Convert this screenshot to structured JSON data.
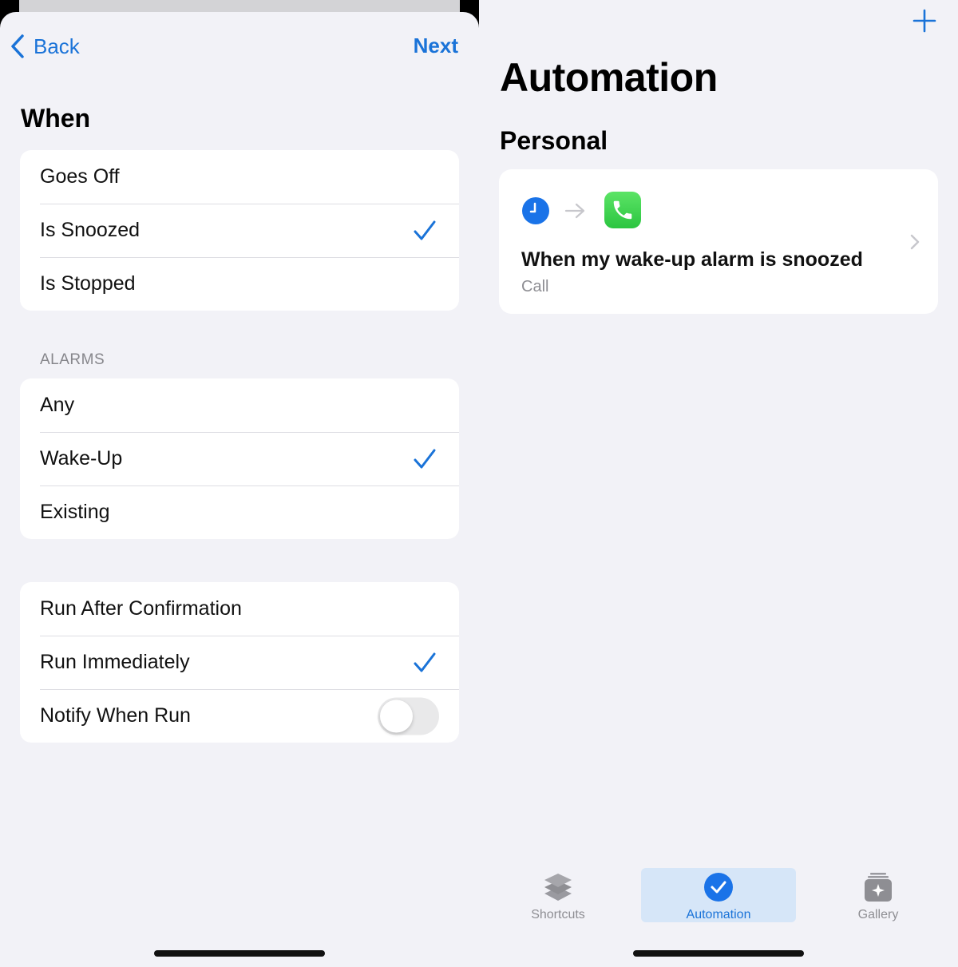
{
  "left": {
    "nav": {
      "back_label": "Back",
      "next_label": "Next"
    },
    "when": {
      "title": "When",
      "options": [
        {
          "label": "Goes Off",
          "checked": false
        },
        {
          "label": "Is Snoozed",
          "checked": true
        },
        {
          "label": "Is Stopped",
          "checked": false
        }
      ]
    },
    "alarms": {
      "header": "ALARMS",
      "options": [
        {
          "label": "Any",
          "checked": false
        },
        {
          "label": "Wake-Up",
          "checked": true
        },
        {
          "label": "Existing",
          "checked": false
        }
      ]
    },
    "run": {
      "options": [
        {
          "label": "Run After Confirmation",
          "checked": false
        },
        {
          "label": "Run Immediately",
          "checked": true
        }
      ],
      "notify": {
        "label": "Notify When Run",
        "on": false
      }
    }
  },
  "right": {
    "title": "Automation",
    "section": "Personal",
    "card": {
      "title": "When my wake-up alarm is snoozed",
      "subtitle": "Call"
    },
    "tabs": [
      {
        "label": "Shortcuts",
        "active": false
      },
      {
        "label": "Automation",
        "active": true
      },
      {
        "label": "Gallery",
        "active": false
      }
    ]
  },
  "colors": {
    "accent": "#1a73d8",
    "background": "#f2f2f7",
    "call_green": "#34c759",
    "toggle_off": "#e9e9ea"
  },
  "icons": {
    "back": "chevron-left-icon",
    "check": "checkmark-icon",
    "plus": "plus-icon",
    "clock": "clock-icon",
    "arrow": "arrow-right-icon",
    "phone": "phone-icon",
    "chevron": "chevron-right-icon",
    "shortcuts": "layers-icon",
    "automation": "checkmark-circle-icon",
    "gallery": "gallery-icon"
  }
}
